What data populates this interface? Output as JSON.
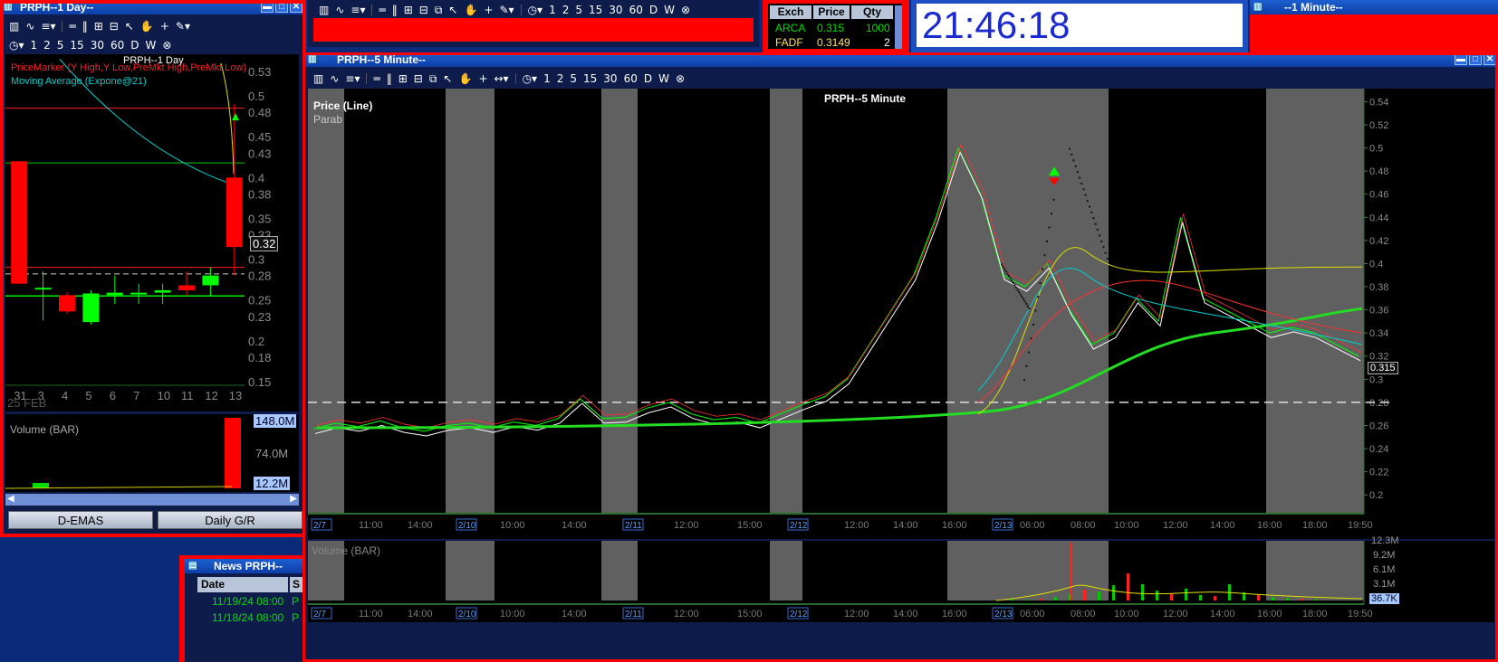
{
  "daily_window": {
    "title": "PRPH--1 Day--",
    "chart_title": "PRPH--1 Day",
    "legend_1": "PriceMarker (Y High,Y Low,PreMkt High,PreMkt Low)",
    "legend_2": "Moving Average (Expone@21)",
    "price_label": "0.32",
    "y_ticks": [
      "0.53",
      "0.5",
      "0.48",
      "0.45",
      "0.43",
      "0.4",
      "0.38",
      "0.35",
      "0.33",
      "0.3",
      "0.28",
      "0.25",
      "0.23",
      "0.2",
      "0.18",
      "0.15"
    ],
    "x_ticks": [
      "31",
      "3",
      "4",
      "5",
      "6",
      "7",
      "10",
      "11",
      "12",
      "13"
    ],
    "month_label": "25 FEB",
    "volume_title": "Volume (BAR)",
    "volume_ticks": [
      "148.0M",
      "74.0M",
      "12.2M"
    ],
    "buttons": [
      "D-EMAS",
      "Daily G/R"
    ],
    "toolbar_numbers": [
      "1",
      "2",
      "5",
      "15",
      "30",
      "60",
      "D",
      "W"
    ],
    "candles": [
      {
        "date": "31",
        "open": 0.42,
        "close": 0.27,
        "high": 0.42,
        "low": 0.27,
        "color": "#ff0000"
      },
      {
        "date": "3",
        "open": 0.265,
        "close": 0.265,
        "high": 0.285,
        "low": 0.225,
        "color": "#00ff00"
      },
      {
        "date": "4",
        "open": 0.256,
        "close": 0.236,
        "high": 0.26,
        "low": 0.233,
        "color": "#ff0000"
      },
      {
        "date": "5",
        "open": 0.223,
        "close": 0.258,
        "high": 0.262,
        "low": 0.22,
        "color": "#00ff00"
      },
      {
        "date": "6",
        "open": 0.256,
        "close": 0.259,
        "high": 0.28,
        "low": 0.245,
        "color": "#00ff00"
      },
      {
        "date": "7",
        "open": 0.259,
        "close": 0.259,
        "high": 0.27,
        "low": 0.245,
        "color": "#00ff00"
      },
      {
        "date": "10",
        "open": 0.259,
        "close": 0.262,
        "high": 0.27,
        "low": 0.245,
        "color": "#00ff00"
      },
      {
        "date": "11",
        "open": 0.268,
        "close": 0.262,
        "high": 0.285,
        "low": 0.255,
        "color": "#ff0000"
      },
      {
        "date": "12",
        "open": 0.268,
        "close": 0.28,
        "high": 0.29,
        "low": 0.255,
        "color": "#00ff00"
      },
      {
        "date": "13",
        "open": 0.4,
        "close": 0.315,
        "high": 0.49,
        "low": 0.28,
        "color": "#ff0000"
      }
    ]
  },
  "main_toolbar": {
    "numbers": [
      "1",
      "2",
      "5",
      "15",
      "30",
      "60",
      "D",
      "W"
    ]
  },
  "quote_box": {
    "headers": [
      "Exch",
      "Price",
      "Qty"
    ],
    "rows": [
      {
        "exch": "ARCA",
        "price": "0.315",
        "qty": "1000"
      },
      {
        "exch": "FADF",
        "price": "0.3149",
        "qty": "2"
      }
    ]
  },
  "clock": {
    "time": "21:46:18"
  },
  "minute_window": {
    "title": "--1 Minute--"
  },
  "five_min_window": {
    "title": "PRPH--5 Minute--",
    "chart_title": "PRPH--5 Minute",
    "legend_1": "Price (Line)",
    "legend_2": "Parab",
    "price_label": "0.315",
    "y_ticks": [
      "0.54",
      "0.52",
      "0.5",
      "0.48",
      "0.46",
      "0.44",
      "0.42",
      "0.4",
      "0.38",
      "0.36",
      "0.34",
      "0.32",
      "0.3",
      "0.28",
      "0.26",
      "0.24",
      "0.22",
      "0.2"
    ],
    "x_labels": [
      {
        "text": "2/7",
        "box": true
      },
      {
        "text": "11:00"
      },
      {
        "text": "14:00"
      },
      {
        "text": "2/10",
        "box": true
      },
      {
        "text": "10:00"
      },
      {
        "text": "14:00"
      },
      {
        "text": "2/11",
        "box": true
      },
      {
        "text": "12:00"
      },
      {
        "text": "15:00"
      },
      {
        "text": "2/12",
        "box": true
      },
      {
        "text": "12:00"
      },
      {
        "text": "14:00"
      },
      {
        "text": "16:00"
      },
      {
        "text": "2/13",
        "box": true
      },
      {
        "text": "06:00"
      },
      {
        "text": "08:00"
      },
      {
        "text": "10:00"
      },
      {
        "text": "12:00"
      },
      {
        "text": "14:00"
      },
      {
        "text": "16:00"
      },
      {
        "text": "18:00"
      },
      {
        "text": "19:50"
      }
    ],
    "volume_title": "Volume (BAR)",
    "volume_ticks": [
      "12.3M",
      "9.2M",
      "6.1M",
      "3.1M",
      "36.7K"
    ],
    "toolbar_numbers": [
      "1",
      "2",
      "5",
      "15",
      "30",
      "60",
      "D",
      "W"
    ],
    "price_series": [
      0.257,
      0.262,
      0.259,
      0.264,
      0.258,
      0.255,
      0.26,
      0.262,
      0.258,
      0.263,
      0.26,
      0.266,
      0.283,
      0.266,
      0.267,
      0.275,
      0.28,
      0.27,
      0.265,
      0.267,
      0.262,
      0.27,
      0.278,
      0.285,
      0.3,
      0.33,
      0.36,
      0.39,
      0.44,
      0.5,
      0.46,
      0.39,
      0.38,
      0.4,
      0.36,
      0.33,
      0.34,
      0.37,
      0.35,
      0.44,
      0.37,
      0.36,
      0.35,
      0.34,
      0.345,
      0.34,
      0.33,
      0.32
    ]
  },
  "news_window": {
    "title": "News PRPH--",
    "headers": [
      "Date",
      "S"
    ],
    "rows": [
      {
        "date": "11/19/24 08:00",
        "s": "P"
      },
      {
        "date": "11/18/24 08:00",
        "s": "P"
      }
    ]
  },
  "colors": {
    "accent": "#ff0000",
    "up": "#00ff00",
    "down": "#ff0000",
    "ema": "#00d0d0",
    "title_bar": "#1d5fd0"
  }
}
